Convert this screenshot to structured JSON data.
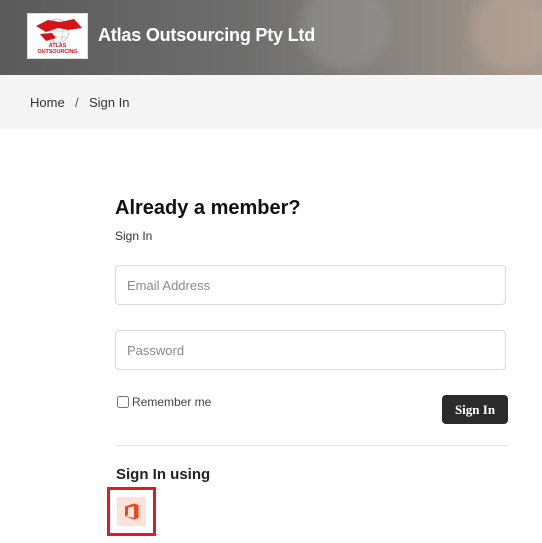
{
  "header": {
    "logo_text": "ATLAS OUTSOURCING",
    "brand": "Atlas Outsourcing Pty Ltd"
  },
  "breadcrumb": {
    "home": "Home",
    "separator": "/",
    "current": "Sign In"
  },
  "form": {
    "heading": "Already a member?",
    "subheading": "Sign In",
    "email_placeholder": "Email Address",
    "password_placeholder": "Password",
    "remember_label": "Remember me",
    "submit_label": "Sign In"
  },
  "sso": {
    "heading": "Sign In using",
    "providers": [
      {
        "icon": "office-icon",
        "color": "#e8481c"
      }
    ]
  },
  "colors": {
    "button_bg": "#2b2b2b",
    "highlight": "#e01b24",
    "office": "#e8481c"
  }
}
